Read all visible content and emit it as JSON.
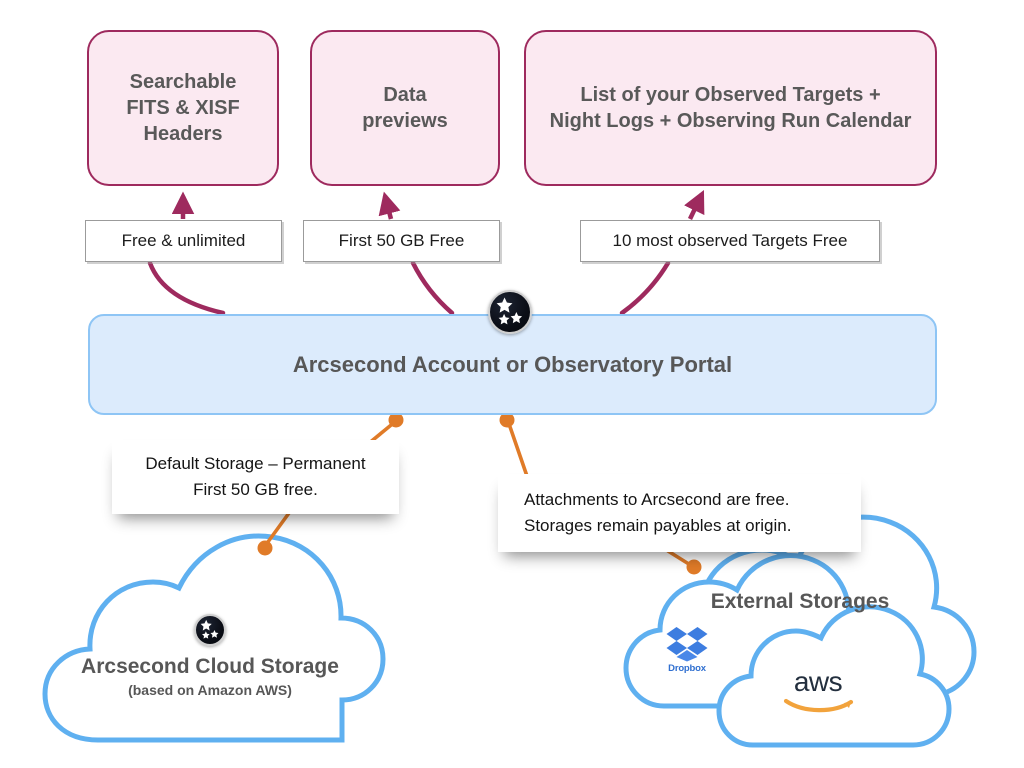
{
  "colors": {
    "feature_fill": "#fbe9f1",
    "feature_border": "#9e2a5e",
    "connector_maroon": "#9e2a5e",
    "portal_fill": "#dcebfc",
    "portal_border": "#8ec5f5",
    "cloud_stroke": "#5fb0f0",
    "callout_connector": "#e07b28",
    "text_grey": "#575757",
    "dropbox_blue": "#2f6fd0",
    "aws_orange": "#f2a33c",
    "aws_dark": "#232f3e"
  },
  "features": [
    {
      "label": "Searchable\nFITS & XISF\nHeaders",
      "lines": [
        "Searchable",
        "FITS & XISF",
        "Headers"
      ]
    },
    {
      "label": "Data previews",
      "lines": [
        "Data",
        "previews"
      ]
    },
    {
      "label": "List of your Observed Targets + Night Logs + Observing Run Calendar",
      "lines": [
        "List of your Observed Targets +",
        "Night Logs + Observing Run Calendar"
      ]
    }
  ],
  "plates": [
    {
      "label": "Free & unlimited"
    },
    {
      "label": "First 50 GB Free"
    },
    {
      "label": "10 most observed Targets Free"
    }
  ],
  "portal": {
    "title": "Arcsecond Account or Observatory Portal",
    "badge_icon": "arcsecond-stars-icon"
  },
  "callouts": [
    {
      "lines": [
        "Default Storage – Permanent",
        "First 50 GB free."
      ]
    },
    {
      "lines": [
        "Attachments to Arcsecond are free.",
        "Storages remain payables at origin."
      ]
    }
  ],
  "clouds": {
    "arcsecond": {
      "title": "Arcsecond Cloud Storage",
      "subtitle": "(based on Amazon AWS)",
      "badge_icon": "arcsecond-stars-icon"
    },
    "external": {
      "title": "External Storages",
      "providers": [
        {
          "name": "Dropbox",
          "wordmark": "Dropbox",
          "icon": "dropbox-icon"
        },
        {
          "name": "aws",
          "wordmark": "aws",
          "icon": "aws-icon"
        }
      ]
    }
  }
}
